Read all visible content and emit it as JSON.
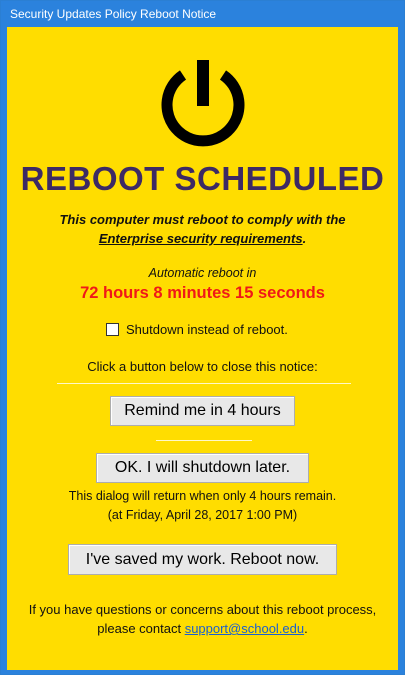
{
  "window": {
    "title": "Security Updates Policy Reboot Notice"
  },
  "icon": "power-icon",
  "headline": "REBOOT SCHEDULED",
  "message": {
    "line1": "This computer must reboot to comply with the",
    "link_text": "Enterprise security requirements",
    "line2_suffix": "."
  },
  "countdown": {
    "label": "Automatic reboot in",
    "value": "72 hours 8 minutes 15 seconds",
    "color": "#f01818"
  },
  "shutdown_option": {
    "label": "Shutdown instead of reboot.",
    "checked": false
  },
  "instructions": "Click a button below to close this notice:",
  "buttons": {
    "remind": "Remind me in 4 hours",
    "ok_shutdown": "OK. I will shutdown later.",
    "reboot_now": "I've saved my work. Reboot now."
  },
  "return_note": {
    "line1": "This dialog will return when only 4 hours remain.",
    "line2": "(at Friday, April 28, 2017 1:00 PM)"
  },
  "footer": {
    "line1": "If you have questions or concerns about this reboot process,",
    "line2_prefix": "please contact ",
    "email": "support@school.edu",
    "line2_suffix": "."
  },
  "colors": {
    "titlebar": "#2b82dd",
    "background": "#ffdd00",
    "headline": "#3d2a64"
  }
}
